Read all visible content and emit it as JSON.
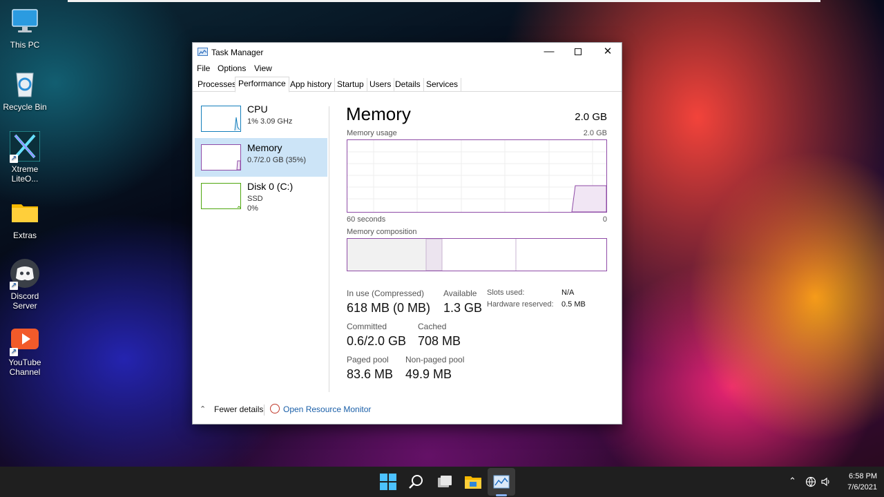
{
  "desktop": {
    "icons": [
      {
        "label": "This PC"
      },
      {
        "label": "Recycle Bin"
      },
      {
        "label": "Xtreme LiteO..."
      },
      {
        "label": "Extras"
      },
      {
        "label": "Discord Server"
      },
      {
        "label": "YouTube Channel"
      }
    ]
  },
  "window": {
    "title": "Task Manager",
    "menu": [
      "File",
      "Options",
      "View"
    ],
    "tabs": [
      "Processes",
      "Performance",
      "App history",
      "Startup",
      "Users",
      "Details",
      "Services"
    ],
    "active_tab": "Performance",
    "sidebar": [
      {
        "name": "CPU",
        "line1": "1% 3.09 GHz",
        "line2": ""
      },
      {
        "name": "Memory",
        "line1": "0.7/2.0 GB (35%)",
        "line2": ""
      },
      {
        "name": "Disk 0 (C:)",
        "line1": "SSD",
        "line2": "0%"
      }
    ],
    "main": {
      "heading": "Memory",
      "total": "2.0 GB",
      "usage_label": "Memory usage",
      "usage_max": "2.0 GB",
      "axis_left": "60 seconds",
      "axis_right": "0",
      "composition_label": "Memory composition",
      "stats": {
        "in_use_label": "In use (Compressed)",
        "in_use_value": "618 MB (0 MB)",
        "available_label": "Available",
        "available_value": "1.3 GB",
        "committed_label": "Committed",
        "committed_value": "0.6/2.0 GB",
        "cached_label": "Cached",
        "cached_value": "708 MB",
        "paged_label": "Paged pool",
        "paged_value": "83.6 MB",
        "nonpaged_label": "Non-paged pool",
        "nonpaged_value": "49.9 MB",
        "slots_label": "Slots used:",
        "slots_value": "N/A",
        "hw_label": "Hardware reserved:",
        "hw_value": "0.5 MB"
      }
    },
    "footer": {
      "fewer_details": "Fewer details",
      "open_resource_monitor": "Open Resource Monitor"
    }
  },
  "taskbar": {
    "time": "6:58 PM",
    "date": "7/6/2021"
  },
  "colors": {
    "memory_accent": "#8e4aa6",
    "cpu_accent": "#117dbb",
    "disk_accent": "#4da60c",
    "selected_bg": "#cce4f7",
    "link": "#1a5fa8"
  }
}
